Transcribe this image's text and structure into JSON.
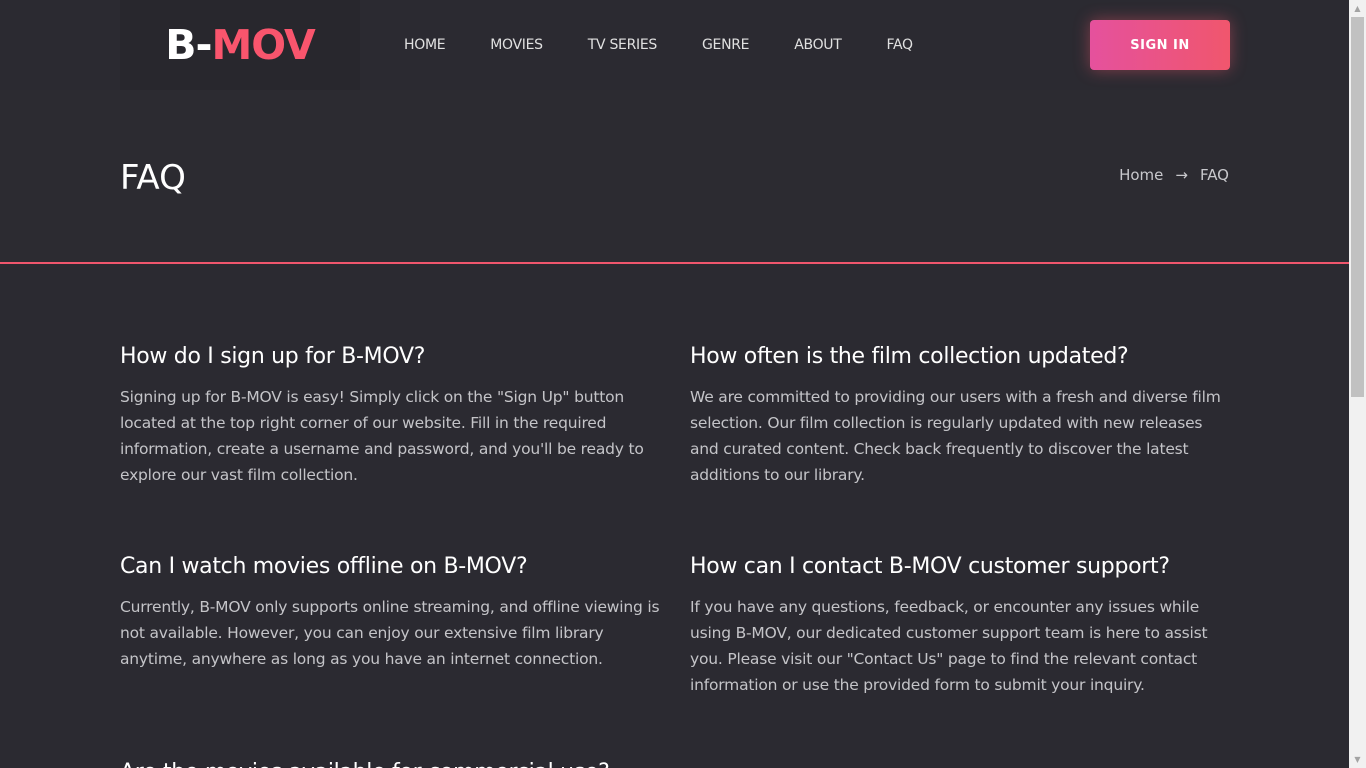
{
  "header": {
    "logo_part1": "B-",
    "logo_part2": "MOV",
    "nav": [
      "HOME",
      "MOVIES",
      "TV SERIES",
      "GENRE",
      "ABOUT",
      "FAQ"
    ],
    "signin_label": "SIGN IN"
  },
  "title_band": {
    "title": "FAQ",
    "breadcrumb_home": "Home",
    "breadcrumb_arrow": "→",
    "breadcrumb_current": "FAQ"
  },
  "faqs": [
    {
      "question": "How do I sign up for B-MOV?",
      "answer": "Signing up for B-MOV is easy! Simply click on the \"Sign Up\" button located at the top right corner of our website. Fill in the required information, create a username and password, and you'll be ready to explore our vast film collection."
    },
    {
      "question": "How often is the film collection updated?",
      "answer": "We are committed to providing our users with a fresh and diverse film selection. Our film collection is regularly updated with new releases and curated content. Check back frequently to discover the latest additions to our library."
    },
    {
      "question": "Can I watch movies offline on B-MOV?",
      "answer": "Currently, B-MOV only supports online streaming, and offline viewing is not available. However, you can enjoy our extensive film library anytime, anywhere as long as you have an internet connection."
    },
    {
      "question": "How can I contact B-MOV customer support?",
      "answer": "If you have any questions, feedback, or encounter any issues while using B-MOV, our dedicated customer support team is here to assist you. Please visit our \"Contact Us\" page to find the relevant contact information or use the provided form to submit your inquiry."
    },
    {
      "question": "Are the movies available for commercial use?",
      "answer": ""
    }
  ],
  "colors": {
    "background": "#2b2a31",
    "accent": "#f0566d",
    "button_gradient_start": "#e5519d",
    "button_gradient_end": "#f0566d"
  },
  "icons": {
    "breadcrumb_separator": "arrow-right-icon",
    "scroll_up": "triangle-up-icon",
    "scroll_down": "triangle-down-icon"
  }
}
